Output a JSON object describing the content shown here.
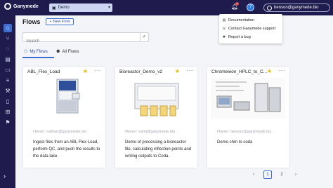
{
  "app": {
    "name": "Ganymede"
  },
  "env": {
    "label": "Demo"
  },
  "notifications": {
    "count": "1"
  },
  "user": {
    "email": "benson@ganymede.bio"
  },
  "help_menu": {
    "items": [
      {
        "label": "Documentation",
        "icon": "document-icon"
      },
      {
        "label": "Contact Ganymede support",
        "icon": "support-icon"
      },
      {
        "label": "Report a bug",
        "icon": "bug-icon"
      }
    ]
  },
  "page": {
    "title": "Flows",
    "new_flow_label": "New Flow"
  },
  "search": {
    "placeholder": "Search"
  },
  "tabs": [
    {
      "label": "My Flows",
      "active": true
    },
    {
      "label": "All Flows",
      "active": false
    }
  ],
  "cards": [
    {
      "title": "ABL_Flex_Load",
      "owner": "Owner: nathan@ganymede.bio",
      "description": "Ingest files from an ABL Flex Load, perform QC, and push the results to the data lake."
    },
    {
      "title": "Bioreactor_Demo_v2",
      "owner": "Owner: sami@ganymede.bio",
      "description": "Demo of processing a bioreactor file, calculating inflection points and writing outputs to Coda."
    },
    {
      "title": "Chromeleon_HPLC_to_C...",
      "owner": "Owner: benson@ganymede.bio",
      "description": "Demo chm to coda"
    }
  ],
  "pagination": {
    "prev": "‹",
    "pages": [
      "1",
      "2"
    ],
    "next": "›",
    "current": 1
  },
  "colors": {
    "nav": "#1f1b4d",
    "accent": "#3f6ed1",
    "star": "#f0b400"
  }
}
